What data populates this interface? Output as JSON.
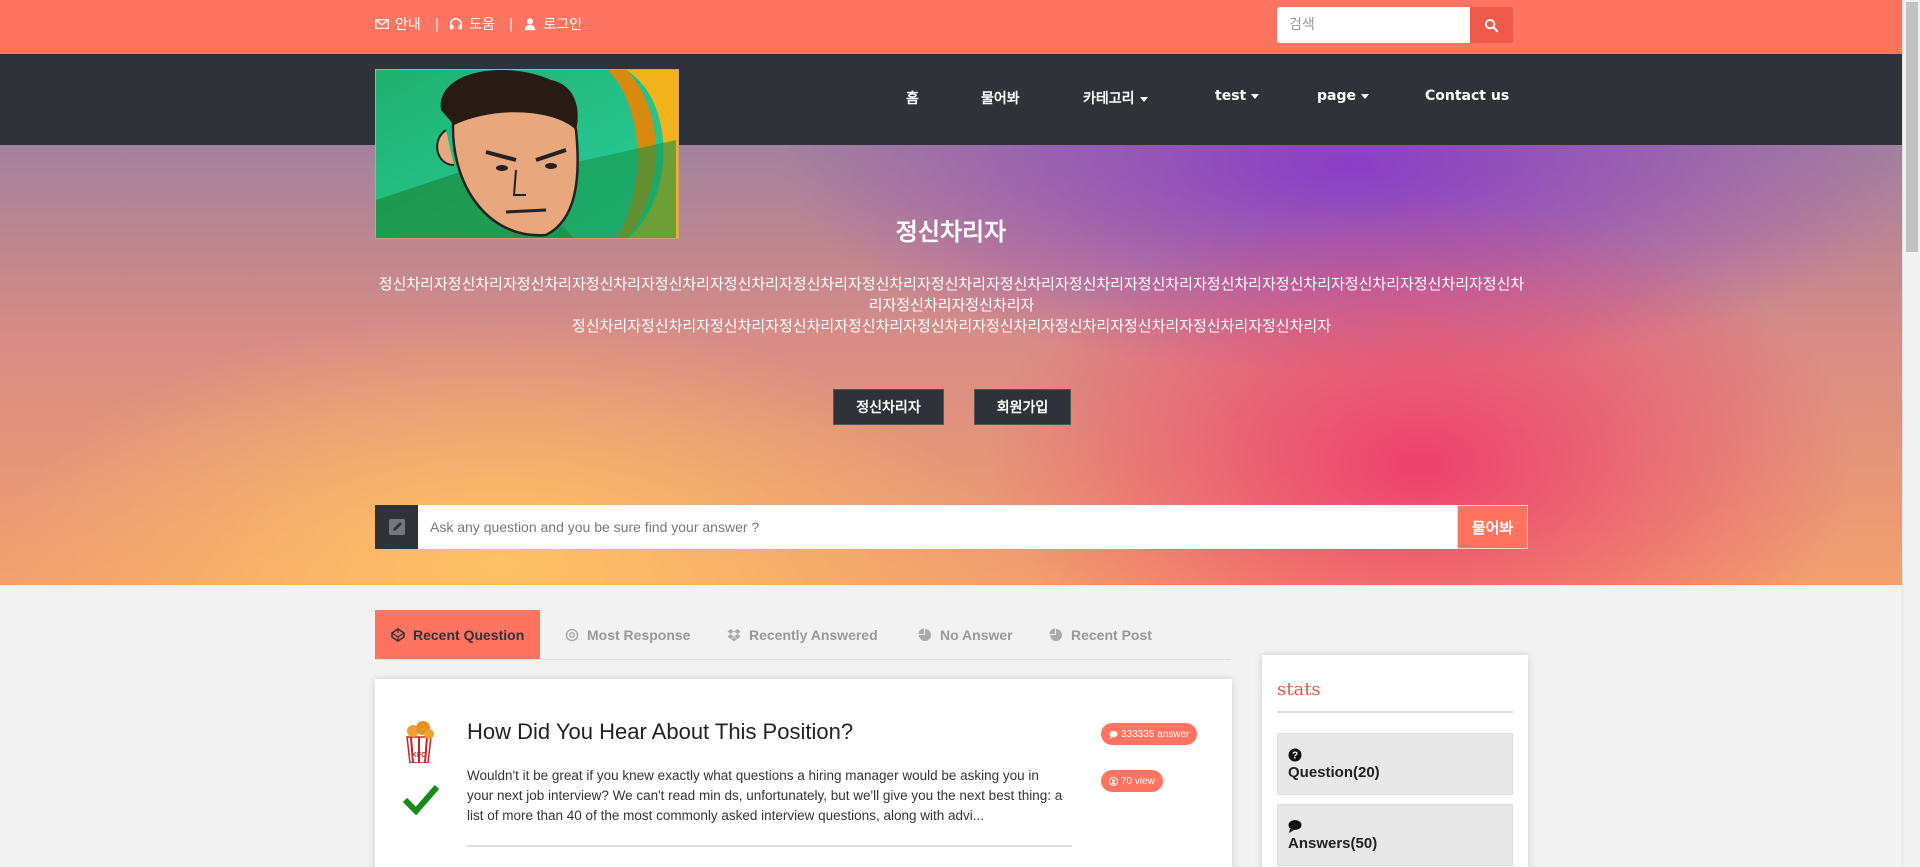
{
  "topbar": {
    "links": [
      {
        "label": "안내",
        "icon": "envelope-icon"
      },
      {
        "label": "도움",
        "icon": "headphones-icon"
      },
      {
        "label": "로그인",
        "icon": "user-icon"
      }
    ],
    "separator": "|",
    "search_placeholder": "검색"
  },
  "nav": {
    "items": [
      {
        "label": "홈",
        "dropdown": false
      },
      {
        "label": "물어봐",
        "dropdown": false
      },
      {
        "label": "카테고리",
        "dropdown": true
      },
      {
        "label": "test",
        "dropdown": true
      },
      {
        "label": "page",
        "dropdown": true
      },
      {
        "label": "Contact us",
        "dropdown": false
      }
    ]
  },
  "hero": {
    "title": "정신차리자",
    "description_line1": "정신차리자정신차리자정신차리자정신차리자정신차리자정신차리자정신차리자정신차리자정신차리자정신차리자정신차리자정신차리자정신차리자정신차리자정신차리자정신차리자정신차리자정신차리자정신차리자",
    "description_line2": "정신차리자정신차리자정신차리자정신차리자정신차리자정신차리자정신차리자정신차리자정신차리자정신차리자정신차리자",
    "buttons": [
      "정신차리자",
      "회원가입"
    ],
    "ask_placeholder": "Ask any question and you be sure find your answer ?",
    "ask_button": "물어봐"
  },
  "tabs": [
    {
      "label": "Recent Question",
      "active": true,
      "icon": "codepen-icon"
    },
    {
      "label": "Most Response",
      "active": false,
      "icon": "life-ring-icon"
    },
    {
      "label": "Recently Answered",
      "active": false,
      "icon": "dropbox-icon"
    },
    {
      "label": "No Answer",
      "active": false,
      "icon": "pie-chart-icon"
    },
    {
      "label": "Recent Post",
      "active": false,
      "icon": "pie-chart-icon"
    }
  ],
  "question": {
    "title": "How Did You Hear About This Position?",
    "excerpt": "Wouldn't it be great if you knew exactly what questions a hiring manager would be asking you in your next job interview? We can't read min ds, unfortunately, but we'll give you the next best thing: a list of more than 40 of the most commonly asked interview questions, along with advi...",
    "answers_badge": "333335 answer",
    "views_badge": "70 view",
    "solved": true
  },
  "stats": {
    "title": "stats",
    "items": [
      {
        "label": "Question(20)",
        "icon": "question-circle-icon"
      },
      {
        "label": "Answers(50)",
        "icon": "comment-icon"
      }
    ]
  },
  "colors": {
    "accent": "#ff7361",
    "dark": "#2f3239",
    "check": "#1a8a1a"
  }
}
